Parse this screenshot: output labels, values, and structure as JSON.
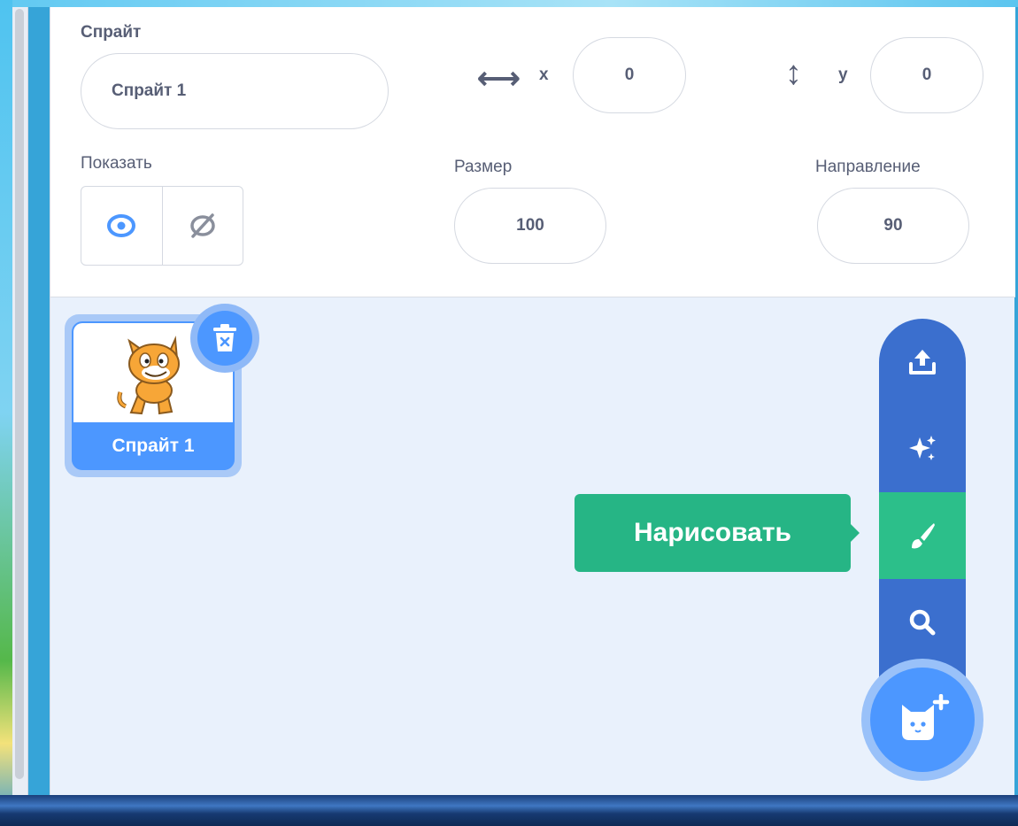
{
  "sprite_info": {
    "sprite_label": "Спрайт",
    "sprite_name": "Спрайт 1",
    "x_label": "x",
    "x_value": "0",
    "y_label": "y",
    "y_value": "0",
    "show_label": "Показать",
    "size_label": "Размер",
    "size_value": "100",
    "direction_label": "Направление",
    "direction_value": "90"
  },
  "sprites": [
    {
      "name": "Спрайт 1",
      "selected": true
    }
  ],
  "add_menu": {
    "items": [
      "upload-icon",
      "surprise-icon",
      "paint-icon",
      "search-icon"
    ],
    "active_item": "paint-icon",
    "tooltip": "Нарисовать"
  },
  "colors": {
    "accent": "#4c97ff",
    "menu_blue": "#3b6fce",
    "active_green": "#2cbf8a",
    "text": "#575e75"
  }
}
